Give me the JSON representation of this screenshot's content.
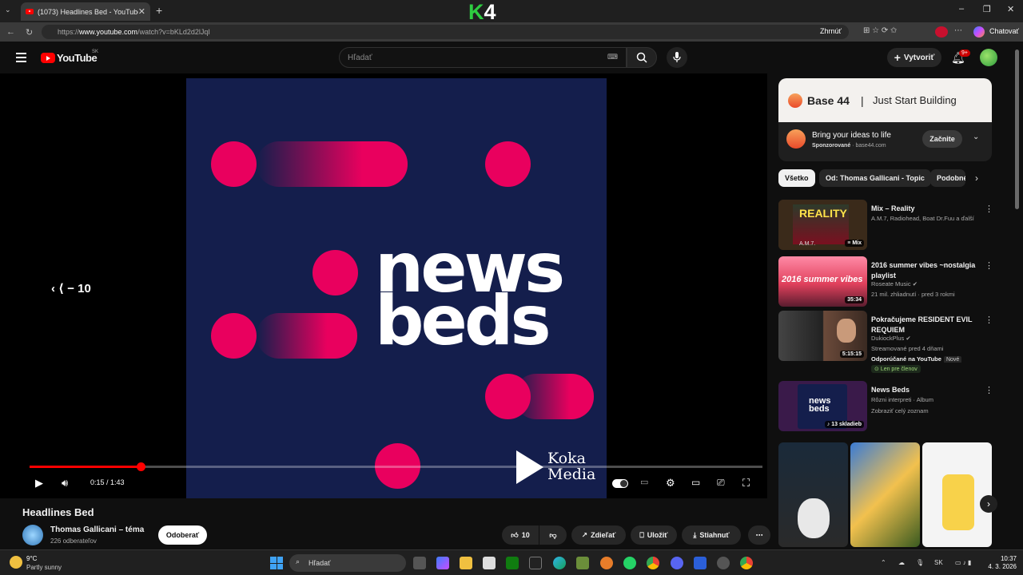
{
  "browser": {
    "tab_title": "(1073) Headlines Bed - YouTube",
    "url_prefix": "https://",
    "url_host": "www.youtube.com",
    "url_path": "/watch?v=bKLd2d2lJqI",
    "summarize_label": "Zhrnúť",
    "chat_label": "Chatovať",
    "overlay_logo": "K4"
  },
  "yt": {
    "logo_text": "YouTube",
    "region": "SK",
    "search_placeholder": "Hľadať",
    "create_label": "Vytvoriť",
    "notif_count": "9+"
  },
  "player": {
    "cover_word_1": "news",
    "cover_word_2": "beds",
    "brand_line1": "Koka",
    "brand_line2": "Media",
    "seek_hint": "− 10",
    "current_time": "0:15",
    "duration": "1:43",
    "progress_fraction": 0.152
  },
  "video": {
    "title": "Headlines Bed",
    "channel": "Thomas Gallicani – téma",
    "subscribers": "226 odberateľov",
    "subscribe_label": "Odoberať",
    "likes": "10",
    "share_label": "Zdieľať",
    "save_label": "Uložiť",
    "download_label": "Stiahnuť"
  },
  "ad": {
    "brand": "Base 44",
    "separator": "|",
    "tagline": "Just Start Building",
    "headline": "Bring your ideas to life",
    "sponsored": "Sponzorované",
    "domain": "base44.com",
    "cta": "Začnite"
  },
  "chips": [
    "Všetko",
    "Od: Thomas Gallicani - Topic",
    "Podobné"
  ],
  "recs": [
    {
      "title": "Mix – Reality",
      "meta1": "A.M.7, Radiohead, Boat Dr.Fuu a ďalší",
      "badge": "Mix",
      "thumb_text": "REALITY",
      "thumb_sub": "A.M.7."
    },
    {
      "title": "2016 summer vibes ~nostalgia playlist",
      "meta1": "Roseate Music",
      "meta2": "21 mil. zhliadnutí · pred 3 rokmi",
      "duration": "35:34",
      "thumb_text": "2016 summer vibes"
    },
    {
      "title": "Pokračujeme RESIDENT EVIL REQUIEM",
      "meta1": "DukiockPlus",
      "meta2": "Streamované pred 4 dňami",
      "meta3": "Odporúčané na YouTube",
      "new_tag": "Nové",
      "members": "Len pre členov",
      "duration": "5:15:15"
    },
    {
      "title": "News Beds",
      "meta1": "Rôzni interpreti · Album",
      "meta2": "Zobraziť celý zoznam",
      "badge": "13 skladieb",
      "thumb_text": "news beds"
    }
  ],
  "taskbar": {
    "temp": "9°C",
    "weather": "Partly sunny",
    "search": "Hľadať",
    "lang": "SK",
    "time": "10:37",
    "date": "4. 3. 2026"
  }
}
